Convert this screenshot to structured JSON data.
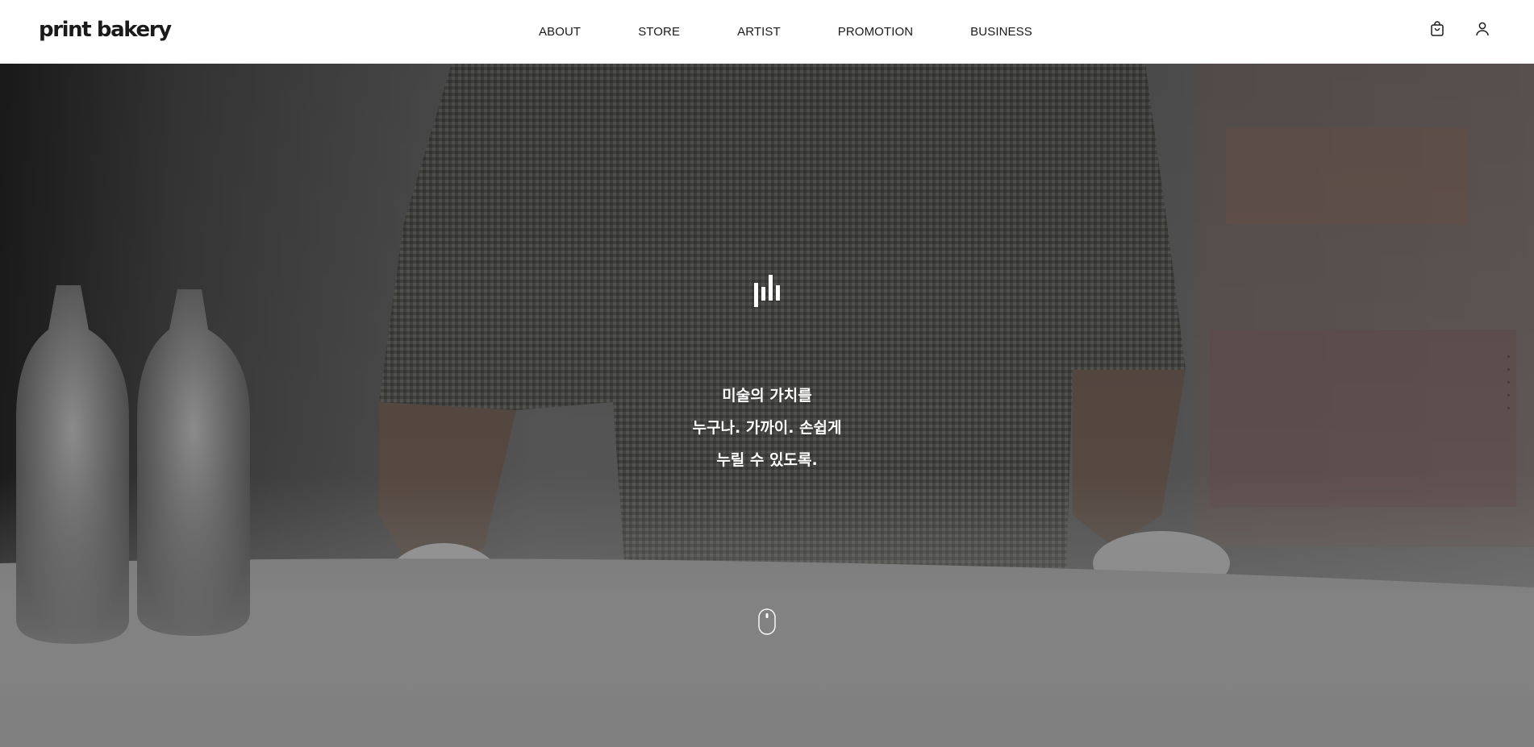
{
  "header": {
    "logo": "print bakery",
    "nav": [
      {
        "label": "ABOUT"
      },
      {
        "label": "STORE"
      },
      {
        "label": "ARTIST"
      },
      {
        "label": "PROMOTION"
      },
      {
        "label": "BUSINESS"
      }
    ],
    "icons": {
      "cart": "shopping-bag-icon",
      "user": "user-icon"
    }
  },
  "hero": {
    "brand_mark": "bars-logo-icon",
    "tagline": [
      "미술의 가치를",
      "누구나. 가까이. 손쉽게",
      "누릴 수 있도록."
    ],
    "scroll_icon": "mouse-scroll-icon",
    "slide_dots_count": 5,
    "colors": {
      "text": "#ffffff",
      "fade_bottom": "#808080"
    }
  }
}
